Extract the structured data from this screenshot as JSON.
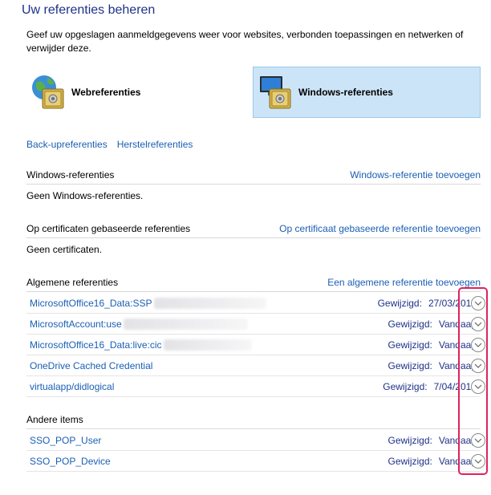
{
  "header": {
    "title": "Uw referenties beheren",
    "description": "Geef uw opgeslagen aanmeldgegevens weer voor websites, verbonden toepassingen en netwerken of verwijder deze."
  },
  "tiles": {
    "web_label": "Webreferenties",
    "windows_label": "Windows-referenties"
  },
  "actions": {
    "backup": "Back-upreferenties",
    "restore": "Herstelreferenties"
  },
  "windows_section": {
    "title": "Windows-referenties",
    "add_link": "Windows-referentie toevoegen",
    "empty": "Geen Windows-referenties."
  },
  "cert_section": {
    "title": "Op certificaten gebaseerde referenties",
    "add_link": "Op certificaat gebaseerde referentie toevoegen",
    "empty": "Geen certificaten."
  },
  "generic_section": {
    "title": "Algemene referenties",
    "add_link": "Een algemene referentie toevoegen",
    "items": [
      {
        "name": "MicrosoftOffice16_Data:SSP",
        "modified_label": "Gewijzigd:",
        "modified_value": "27/03/2016"
      },
      {
        "name": "MicrosoftAccount:use",
        "modified_label": "Gewijzigd:",
        "modified_value": "Vandaag"
      },
      {
        "name": "MicrosoftOffice16_Data:live:cic",
        "modified_label": "Gewijzigd:",
        "modified_value": "Vandaag"
      },
      {
        "name": "OneDrive Cached Credential",
        "modified_label": "Gewijzigd:",
        "modified_value": "Vandaag"
      },
      {
        "name": "virtualapp/didlogical",
        "modified_label": "Gewijzigd:",
        "modified_value": "7/04/2017"
      }
    ]
  },
  "other_section": {
    "title": "Andere items",
    "items": [
      {
        "name": "SSO_POP_User",
        "modified_label": "Gewijzigd:",
        "modified_value": "Vandaag"
      },
      {
        "name": "SSO_POP_Device",
        "modified_label": "Gewijzigd:",
        "modified_value": "Vandaag"
      }
    ]
  },
  "colors": {
    "title": "#1e3287",
    "link": "#1a5fb4",
    "selected_tile": "#cce4f7",
    "highlight": "#e0225b"
  }
}
